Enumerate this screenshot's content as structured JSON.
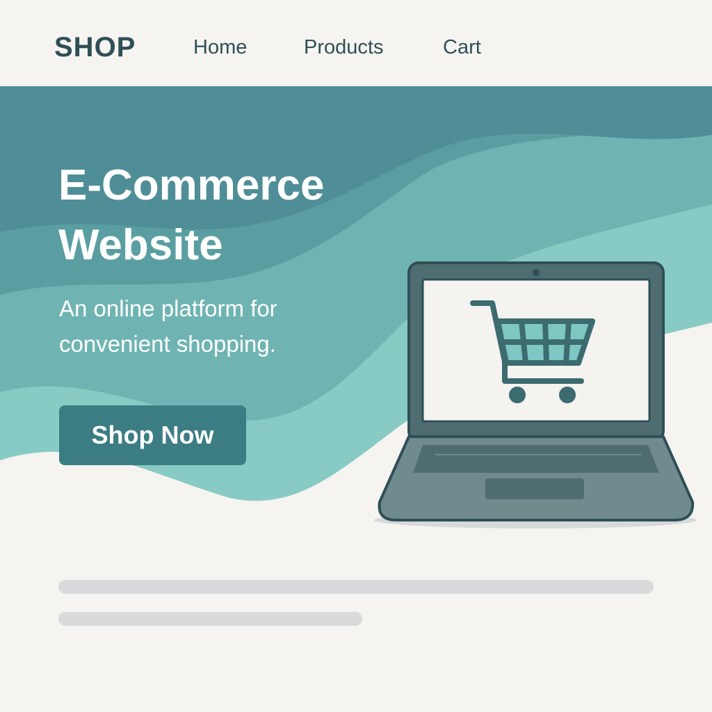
{
  "navbar": {
    "brand": "SHOP",
    "links": [
      {
        "label": "Home"
      },
      {
        "label": "Products"
      },
      {
        "label": "Cart"
      }
    ]
  },
  "hero": {
    "title_line1": "E-Commerce",
    "title_line2": "Website",
    "subtitle_line1": "An online platform for",
    "subtitle_line2": "convenient shopping.",
    "cta_label": "Shop Now"
  },
  "illustration": {
    "laptop_icon": "laptop-icon",
    "screen_icon": "shopping-cart-icon"
  },
  "colors": {
    "background": "#f5f4f0",
    "text_dark": "#2f4f57",
    "hero_teal_dark": "#4f8e96",
    "hero_teal_light": "#88cbc5",
    "button": "#3c7d84",
    "laptop_body": "#4f6d70",
    "placeholder": "#d8dadb"
  }
}
